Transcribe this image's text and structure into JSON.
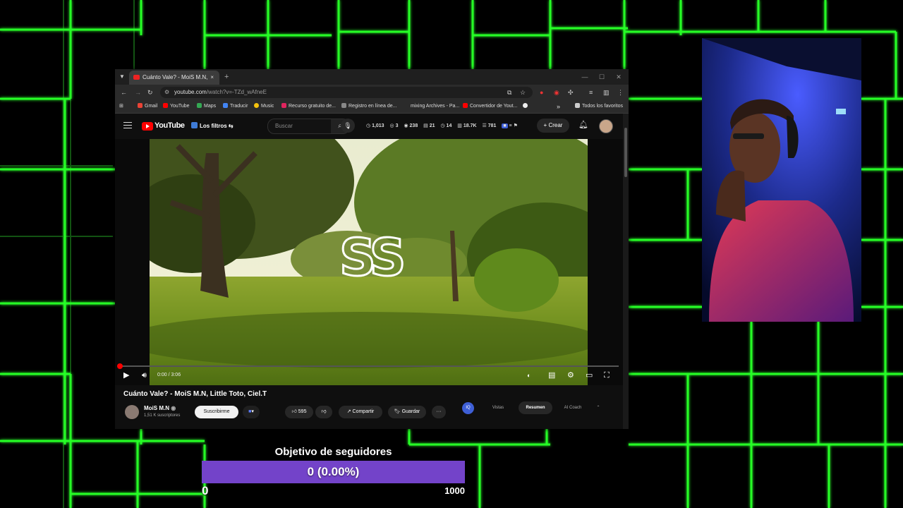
{
  "browser": {
    "tab_title": "Cuánto Vale? - MoiS M.N, Little Toto...",
    "tab_close": "×",
    "new_tab": "+",
    "url_domain": "youtube.com",
    "url_path": "/watch?v=-TZd_wAfneE",
    "bookmarks": [
      "Gmail",
      "YouTube",
      "Maps",
      "Traducir",
      "Music",
      "Recurso gratuito de...",
      "Registro en línea de...",
      "mixing Archives - Pa...",
      "Convertidor de Yout...",
      "Todos los favoritos"
    ],
    "bookmarks_more": "»"
  },
  "youtube": {
    "logo_text": "YouTube",
    "filters_label": "Los filtros",
    "search_placeholder": "Buscar",
    "stats": [
      "1,013",
      "3",
      "238",
      "21",
      "14",
      "18.7K",
      "781"
    ],
    "create_label": "Crear"
  },
  "player": {
    "time": "0:00 / 3:06",
    "progress": 0,
    "overlay_text": "SS"
  },
  "video": {
    "title": "Cuánto Vale? - MoiS M.N, Little Toto, Ciel.T",
    "channel": "MoiS M.N",
    "subscribers": "1,51 K suscriptores",
    "subscribe_label": "Suscribirme",
    "likes": "595",
    "share_label": "Compartir",
    "save_label": "Guardar",
    "more_label": "···"
  },
  "sidepanel": {
    "badge": "IQ",
    "tabs": [
      "Vistas",
      "Resumen",
      "AI Coach"
    ],
    "active_tab": "Resumen"
  },
  "goal": {
    "title": "Objetivo de seguidores",
    "progress_text": "0 (0.00%)",
    "current": "0",
    "target": "1000",
    "fraction": 0,
    "bar_color": "#7343c9"
  },
  "colors": {
    "accent_green": "#20ff20",
    "youtube_red": "#ff0000"
  }
}
